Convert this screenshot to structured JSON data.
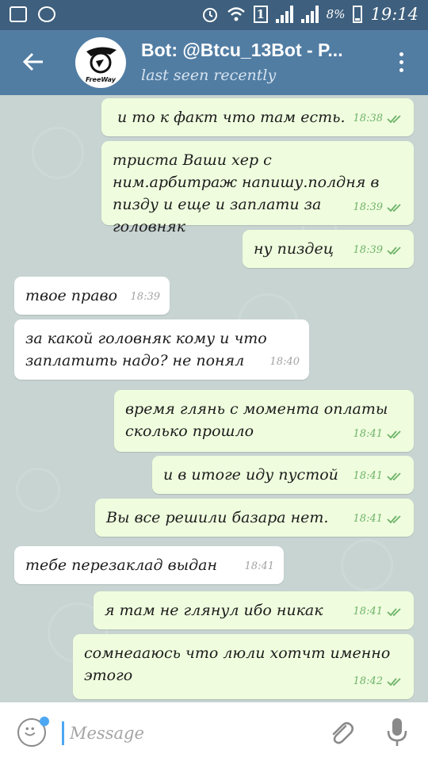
{
  "status_bar": {
    "battery_percent": "8%",
    "time": "19:14",
    "sim_label": "1"
  },
  "header": {
    "title": "Bot: @Btcu_13Bot - P...",
    "subtitle": "last seen recently",
    "avatar_text": "FreeWay"
  },
  "messages": [
    {
      "dir": "out",
      "text": "и то к факт что там есть.",
      "time": "18:38"
    },
    {
      "dir": "out",
      "text": "триста Ваши хер с ним.арбитраж напишу.полдня в пизду и еще и заплати за головняк",
      "time": "18:39"
    },
    {
      "dir": "out",
      "text": "ну пиздец",
      "time": "18:39"
    },
    {
      "dir": "in",
      "text": "твое право",
      "time": "18:39"
    },
    {
      "dir": "in",
      "text": "за какой головняк кому и что заплатить надо? не понял",
      "time": "18:40"
    },
    {
      "dir": "out",
      "text": "время глянь с момента оплаты сколько прошло",
      "time": "18:41"
    },
    {
      "dir": "out",
      "text": "и в итоге иду пустой",
      "time": "18:41"
    },
    {
      "dir": "out",
      "text": "Вы все решили базара нет.",
      "time": "18:41"
    },
    {
      "dir": "in",
      "text": "тебе перезаклад выдан",
      "time": "18:41"
    },
    {
      "dir": "out",
      "text": "я там не глянул ибо никак",
      "time": "18:41"
    },
    {
      "dir": "out",
      "text": "сомнеааюсь что люли хотчт именно этого",
      "time": "18:42"
    }
  ],
  "input": {
    "placeholder": "Message"
  },
  "colors": {
    "status_bar": "#3e5f7d",
    "header": "#527da3",
    "outgoing_bubble": "#effdde",
    "incoming_bubble": "#ffffff",
    "read_check": "#6fb36a",
    "accent": "#4da7f2"
  }
}
